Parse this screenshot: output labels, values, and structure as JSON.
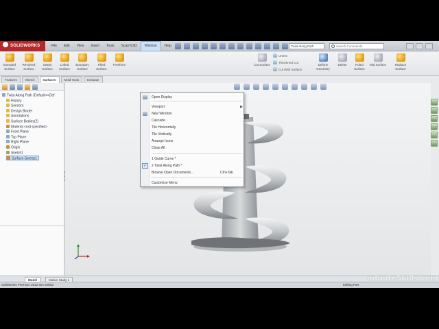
{
  "app": {
    "logo_text": "SOLIDWORKS",
    "menus": [
      "File",
      "Edit",
      "View",
      "Insert",
      "Tools",
      "ScanTo3D",
      "Window",
      "Help"
    ],
    "active_menu_index": 6,
    "document_title": "Twist Along Path",
    "search_placeholder": "Search Commands"
  },
  "ribbon": {
    "buttons": [
      {
        "label": "Extruded Surface",
        "icon": "extruded-surface-icon"
      },
      {
        "label": "Revolved Surface",
        "icon": "revolved-surface-icon"
      },
      {
        "label": "Swept Surface",
        "icon": "swept-surface-icon"
      },
      {
        "label": "Lofted Surface",
        "icon": "lofted-surface-icon"
      },
      {
        "label": "Boundary Surface",
        "icon": "boundary-surface-icon"
      },
      {
        "label": "Filled Surface",
        "icon": "filled-surface-icon"
      },
      {
        "label": "Freeform",
        "icon": "freeform-icon"
      }
    ],
    "right_buttons": [
      {
        "label": "Cut Surface",
        "icon": "cut-surface-icon"
      },
      {
        "label": "Deform Geometry",
        "icon": "deform-geometry-icon"
      },
      {
        "label": "Delete",
        "icon": "delete-face-icon"
      },
      {
        "label": "Ruled Surface",
        "icon": "ruled-surface-icon"
      },
      {
        "label": "Mid Surface",
        "icon": "mid-surface-icon"
      },
      {
        "label": "Replace Surface",
        "icon": "replace-surface-icon"
      }
    ],
    "small_items": [
      "Untrim",
      "Thickened Cut",
      "Cut With Surface"
    ]
  },
  "command_tabs": [
    "Features",
    "Sketch",
    "Surfaces",
    "Mold Tools",
    "Evaluate"
  ],
  "active_command_tab": 2,
  "feature_tree": {
    "items": [
      {
        "label": "Twist Along Path (Default<<Def",
        "icon": "part-icon",
        "color": "b"
      },
      {
        "label": "History",
        "icon": "history-icon",
        "color": "y"
      },
      {
        "label": "Sensors",
        "icon": "sensors-icon",
        "color": "y"
      },
      {
        "label": "Design Binder",
        "icon": "design-binder-icon",
        "color": "y"
      },
      {
        "label": "Annotations",
        "icon": "annotations-icon",
        "color": "y"
      },
      {
        "label": "Surface Bodies(2)",
        "icon": "surface-bodies-icon",
        "color": "y"
      },
      {
        "label": "Material <not specified>",
        "icon": "material-icon",
        "color": "o"
      },
      {
        "label": "Front Plane",
        "icon": "plane-icon",
        "color": "b"
      },
      {
        "label": "Top Plane",
        "icon": "plane-icon",
        "color": "b"
      },
      {
        "label": "Right Plane",
        "icon": "plane-icon",
        "color": "b"
      },
      {
        "label": "Origin",
        "icon": "origin-icon",
        "color": "o"
      },
      {
        "label": "Sketch1",
        "icon": "sketch-icon",
        "color": "g"
      },
      {
        "label": "Surface-Sweep1",
        "icon": "surface-sweep-icon",
        "color": "o"
      }
    ],
    "selected_index": 12
  },
  "window_menu": {
    "items": [
      {
        "label": "Open Display",
        "shortcut": "",
        "submenu": false
      },
      {
        "label": "Viewport",
        "shortcut": "",
        "submenu": true
      },
      {
        "label": "New Window",
        "shortcut": "",
        "submenu": false
      },
      {
        "label": "Cascade",
        "shortcut": "",
        "submenu": false
      },
      {
        "label": "Tile Horizontally",
        "shortcut": "",
        "submenu": false
      },
      {
        "label": "Tile Vertically",
        "shortcut": "",
        "submenu": false
      },
      {
        "label": "Arrange Icons",
        "shortcut": "",
        "submenu": false
      },
      {
        "label": "Close All",
        "shortcut": "",
        "submenu": false
      },
      {
        "label": "1 Guide Curve *",
        "shortcut": "",
        "submenu": false
      },
      {
        "label": "2 Twist Along Path *",
        "shortcut": "",
        "submenu": false,
        "checked": true
      },
      {
        "label": "Browse Open Documents...",
        "shortcut": "Ctrl+Tab",
        "submenu": false
      },
      {
        "label": "Customize Menu",
        "shortcut": "",
        "submenu": false
      }
    ]
  },
  "model_tabs": [
    "Model",
    "Motion Study 1"
  ],
  "status": {
    "left": "SolidWorks Premium 2012 x64 Edition",
    "right": "Editing Part"
  },
  "watermark": "infiniteSkills.com",
  "colors": {
    "brand_red": "#b4292b",
    "viewport_bg": "#eceeef",
    "selection": "#cfe3fb",
    "model_shade": "#b9bcbf"
  }
}
